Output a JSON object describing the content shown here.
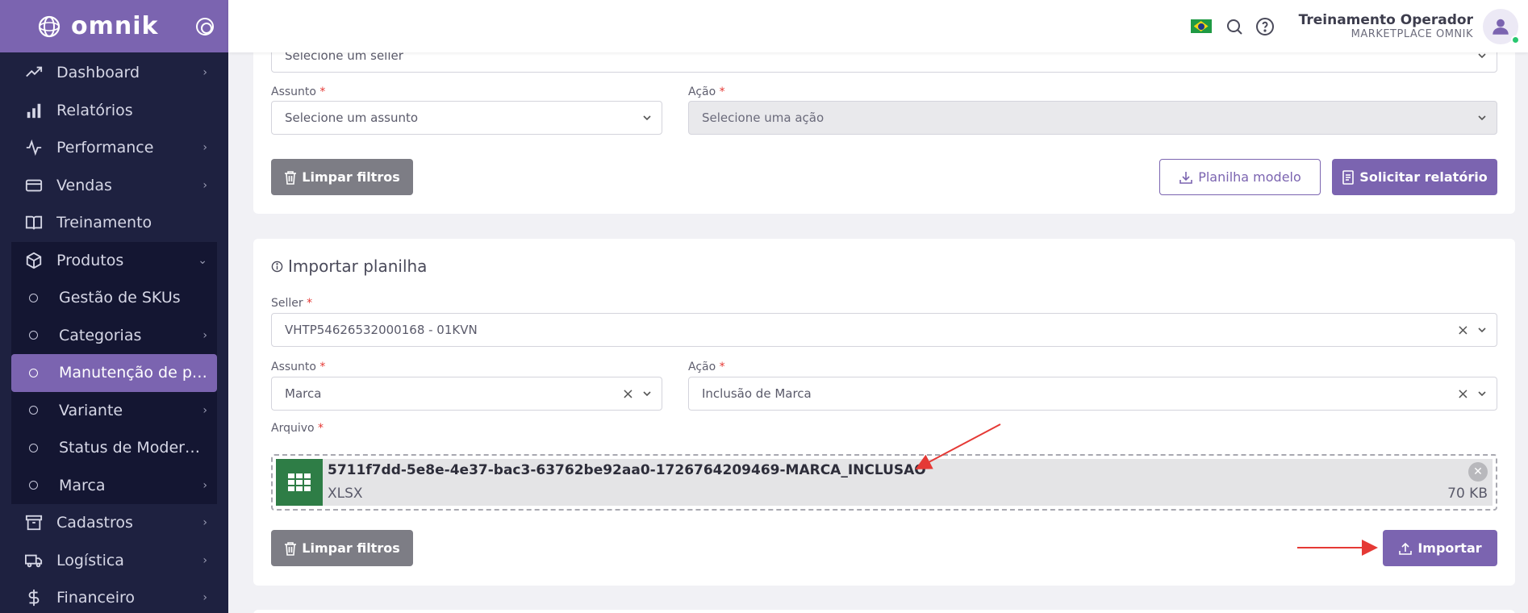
{
  "brand": {
    "name": "omnik"
  },
  "sidebar": {
    "items": [
      {
        "label": "Dashboard",
        "icon": "trending-up-icon"
      },
      {
        "label": "Relatórios",
        "icon": "bar-chart-icon"
      },
      {
        "label": "Performance",
        "icon": "activity-icon"
      },
      {
        "label": "Vendas",
        "icon": "credit-card-icon"
      },
      {
        "label": "Treinamento",
        "icon": "book-open-icon"
      },
      {
        "label": "Produtos",
        "icon": "box-icon"
      },
      {
        "label": "Cadastros",
        "icon": "archive-icon"
      },
      {
        "label": "Logística",
        "icon": "truck-icon"
      },
      {
        "label": "Financeiro",
        "icon": "dollar-icon"
      }
    ],
    "sub_items": [
      {
        "label": "Gestão de SKUs"
      },
      {
        "label": "Categorias"
      },
      {
        "label": "Manutenção de pro..."
      },
      {
        "label": "Variante"
      },
      {
        "label": "Status de Moderaç..."
      },
      {
        "label": "Marca"
      }
    ]
  },
  "header": {
    "user_name": "Treinamento Operador",
    "user_role": "MARKETPLACE OMNIK"
  },
  "filters": {
    "seller_placeholder": "Selecione um seller",
    "assunto_label": "Assunto",
    "assunto_placeholder": "Selecione um assunto",
    "acao_label": "Ação",
    "acao_placeholder": "Selecione uma ação",
    "clear_label": "Limpar filtros",
    "template_label": "Planilha modelo",
    "report_label": "Solicitar relatório"
  },
  "import": {
    "title": "Importar planilha",
    "seller_label": "Seller",
    "seller_value": "VHTP54626532000168 - 01KVN",
    "assunto_label": "Assunto",
    "assunto_value": "Marca",
    "acao_label": "Ação",
    "acao_value": "Inclusão de Marca",
    "arquivo_label": "Arquivo",
    "file_name": "5711f7dd-5e8e-4e37-bac3-63762be92aa0-1726764209469-MARCA_INCLUSAO",
    "file_type": "XLSX",
    "file_size": "70 KB",
    "clear_label": "Limpar filtros",
    "import_label": "Importar"
  },
  "required_mark": "*",
  "colors": {
    "primary": "#7b64b0",
    "sidebar": "#1e2140",
    "annotation": "#e53935"
  }
}
